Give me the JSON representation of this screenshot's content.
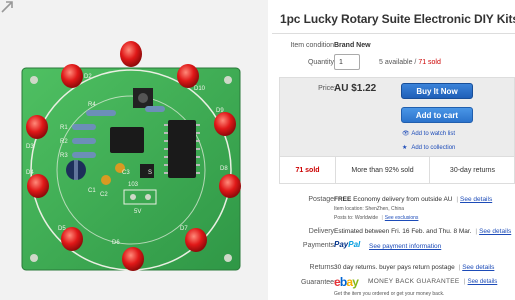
{
  "listing": {
    "title": "1pc Lucky Rotary Suite Electronic DIY Kits Product",
    "condition_label": "Item condition:",
    "condition_value": "Brand New",
    "quantity_label": "Quantity:",
    "quantity_value": "1",
    "available_text": "5 available /",
    "sold_text": "71 sold",
    "price_label": "Price:",
    "price_value": "AU $1.22",
    "buy_now": "Buy It Now",
    "add_to_cart": "Add to cart",
    "watch_list": "Add to watch list",
    "collection": "Add to collection"
  },
  "stats": {
    "sold": "71 sold",
    "positive": "More than 92% sold",
    "returns": "30-day returns"
  },
  "postage": {
    "label": "Postage:",
    "free": "FREE",
    "text": "Economy delivery from outside AU",
    "see_details": "See details",
    "location": "Item location: ShenZhen, China",
    "posts_to": "Posts to: Worldwide",
    "see_exclusions": "See exclusions"
  },
  "delivery": {
    "label": "Delivery:",
    "text": "Estimated between Fri. 16 Feb. and Thu. 8 Mar.",
    "see_details": "See details"
  },
  "payments": {
    "label": "Payments:",
    "paypal_a": "Pay",
    "paypal_b": "Pal",
    "link": "See payment information"
  },
  "returns": {
    "label": "Returns:",
    "text": "30 day returns. buyer pays return postage",
    "see_details": "See details"
  },
  "guarantee": {
    "label": "Guarantee:",
    "logo": [
      "e",
      "b",
      "a",
      "y"
    ],
    "mbg": "MONEY BACK GUARANTEE",
    "see_details": "See details",
    "sub": "Get the item you ordered or get your money back."
  },
  "pcb": {
    "labels": [
      "D1",
      "D2",
      "D3",
      "D4",
      "D5",
      "D6",
      "D7",
      "D8",
      "D9",
      "D10",
      "R1",
      "R2",
      "R3",
      "R4",
      "C1",
      "C2",
      "C3",
      "103",
      "5V",
      "S"
    ],
    "brand_colors": {
      "board": "#3fae55",
      "led": "#e01818",
      "accent": "#0064d2"
    }
  }
}
